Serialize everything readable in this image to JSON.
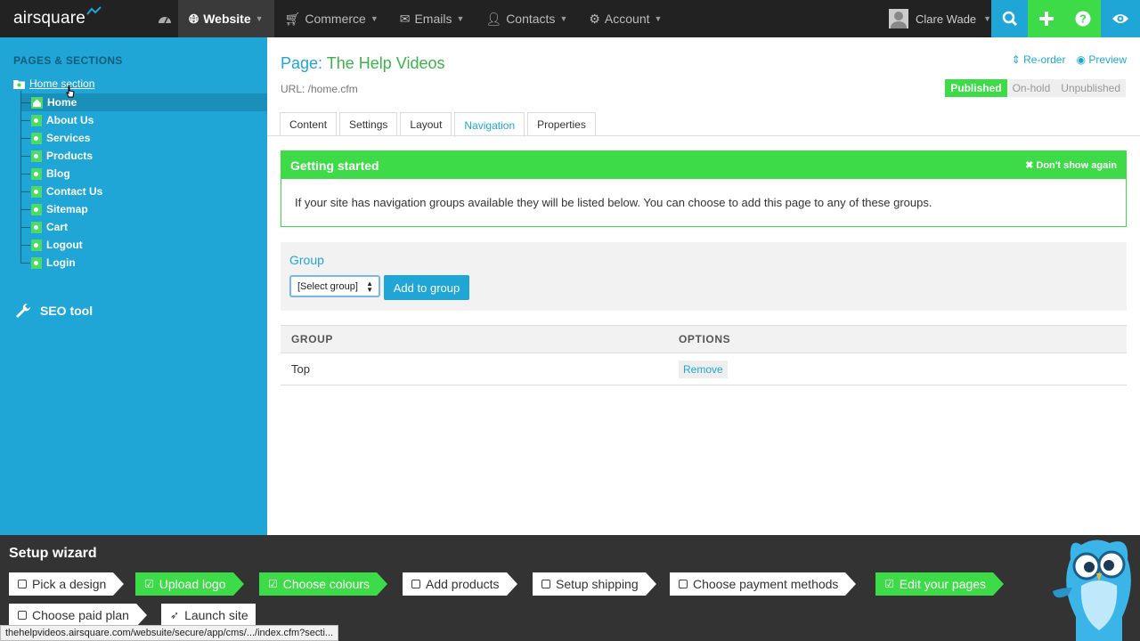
{
  "brand": {
    "name": "airsquare"
  },
  "topnav": {
    "items": [
      {
        "label": "Website",
        "active": true
      },
      {
        "label": "Commerce"
      },
      {
        "label": "Emails"
      },
      {
        "label": "Contacts"
      },
      {
        "label": "Account"
      }
    ],
    "user": "Clare Wade",
    "buttons": [
      "search-icon",
      "plus-icon",
      "help-icon",
      "eye-icon"
    ],
    "button_colors": [
      "#1fa6d6",
      "#3ddb48",
      "#3ddb48",
      "#1fa6d6"
    ]
  },
  "sidebar": {
    "title": "PAGES & SECTIONS",
    "root": "Home section",
    "pages": [
      "Home",
      "About Us",
      "Services",
      "Products",
      "Blog",
      "Contact Us",
      "Sitemap",
      "Cart",
      "Logout",
      "Login"
    ],
    "seo_label": "SEO tool"
  },
  "page": {
    "prefix": "Page:",
    "name": "The Help Videos",
    "url": "URL: /home.cfm",
    "reorder": "Re-order",
    "preview": "Preview",
    "status": [
      "Published",
      "On-hold",
      "Unpublished"
    ],
    "tabs": [
      "Content",
      "Settings",
      "Layout",
      "Navigation",
      "Properties"
    ],
    "active_tab": "Navigation"
  },
  "getting_started": {
    "title": "Getting started",
    "dismiss": "Don't show again",
    "text": "If your site has navigation groups available they will be listed below. You can choose to add this page to any of these groups."
  },
  "group_form": {
    "label": "Group",
    "select_value": "[Select group]",
    "add_label": "Add to group"
  },
  "table": {
    "headers": [
      "GROUP",
      "OPTIONS"
    ],
    "rows": [
      {
        "group": "Top",
        "action": "Remove"
      }
    ]
  },
  "wizard": {
    "title": "Setup wizard",
    "steps": [
      {
        "label": "Pick a design",
        "done": false
      },
      {
        "label": "Upload logo",
        "done": true
      },
      {
        "label": "Choose colours",
        "done": true
      },
      {
        "label": "Add products",
        "done": false
      },
      {
        "label": "Setup shipping",
        "done": false
      },
      {
        "label": "Choose payment methods",
        "done": false
      },
      {
        "label": "Edit your pages",
        "done": true
      },
      {
        "label": "Choose paid plan",
        "done": false
      },
      {
        "label": "Launch site",
        "done": false
      }
    ]
  },
  "statusbar": "thehelpvideos.airsquare.com/websuite/secure/app/cms/.../index.cfm?secti..."
}
